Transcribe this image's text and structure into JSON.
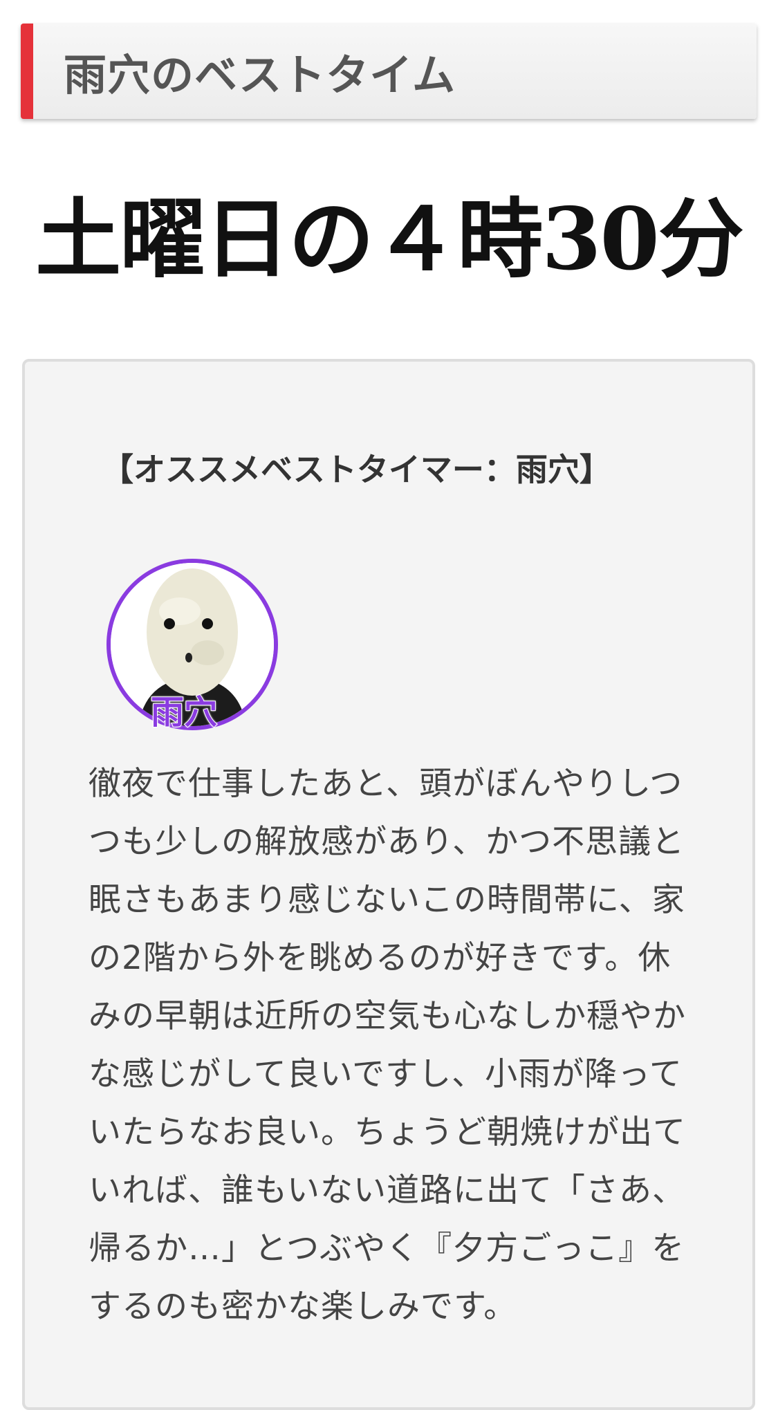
{
  "section_heading": "雨穴のベストタイム",
  "best_time": "土曜日の４時30分",
  "card": {
    "title": "【オススメベストタイマー：雨穴】",
    "avatar_name": "雨穴",
    "body": "徹夜で仕事したあと、頭がぼんやりしつつも少しの解放感があり、かつ不思議と眠さもあまり感じないこの時間帯に、家の2階から外を眺めるのが好きです。休みの早朝は近所の空気も心なしか穏やかな感じがして良いですし、小雨が降っていたらなお良い。ちょうど朝焼けが出ていれば、誰もいない道路に出て「さあ、帰るか…」とつぶやく『夕方ごっこ』をするのも密かな楽しみです。"
  },
  "colors": {
    "heading_accent": "#e5323a",
    "avatar_ring": "#8a3be0"
  }
}
